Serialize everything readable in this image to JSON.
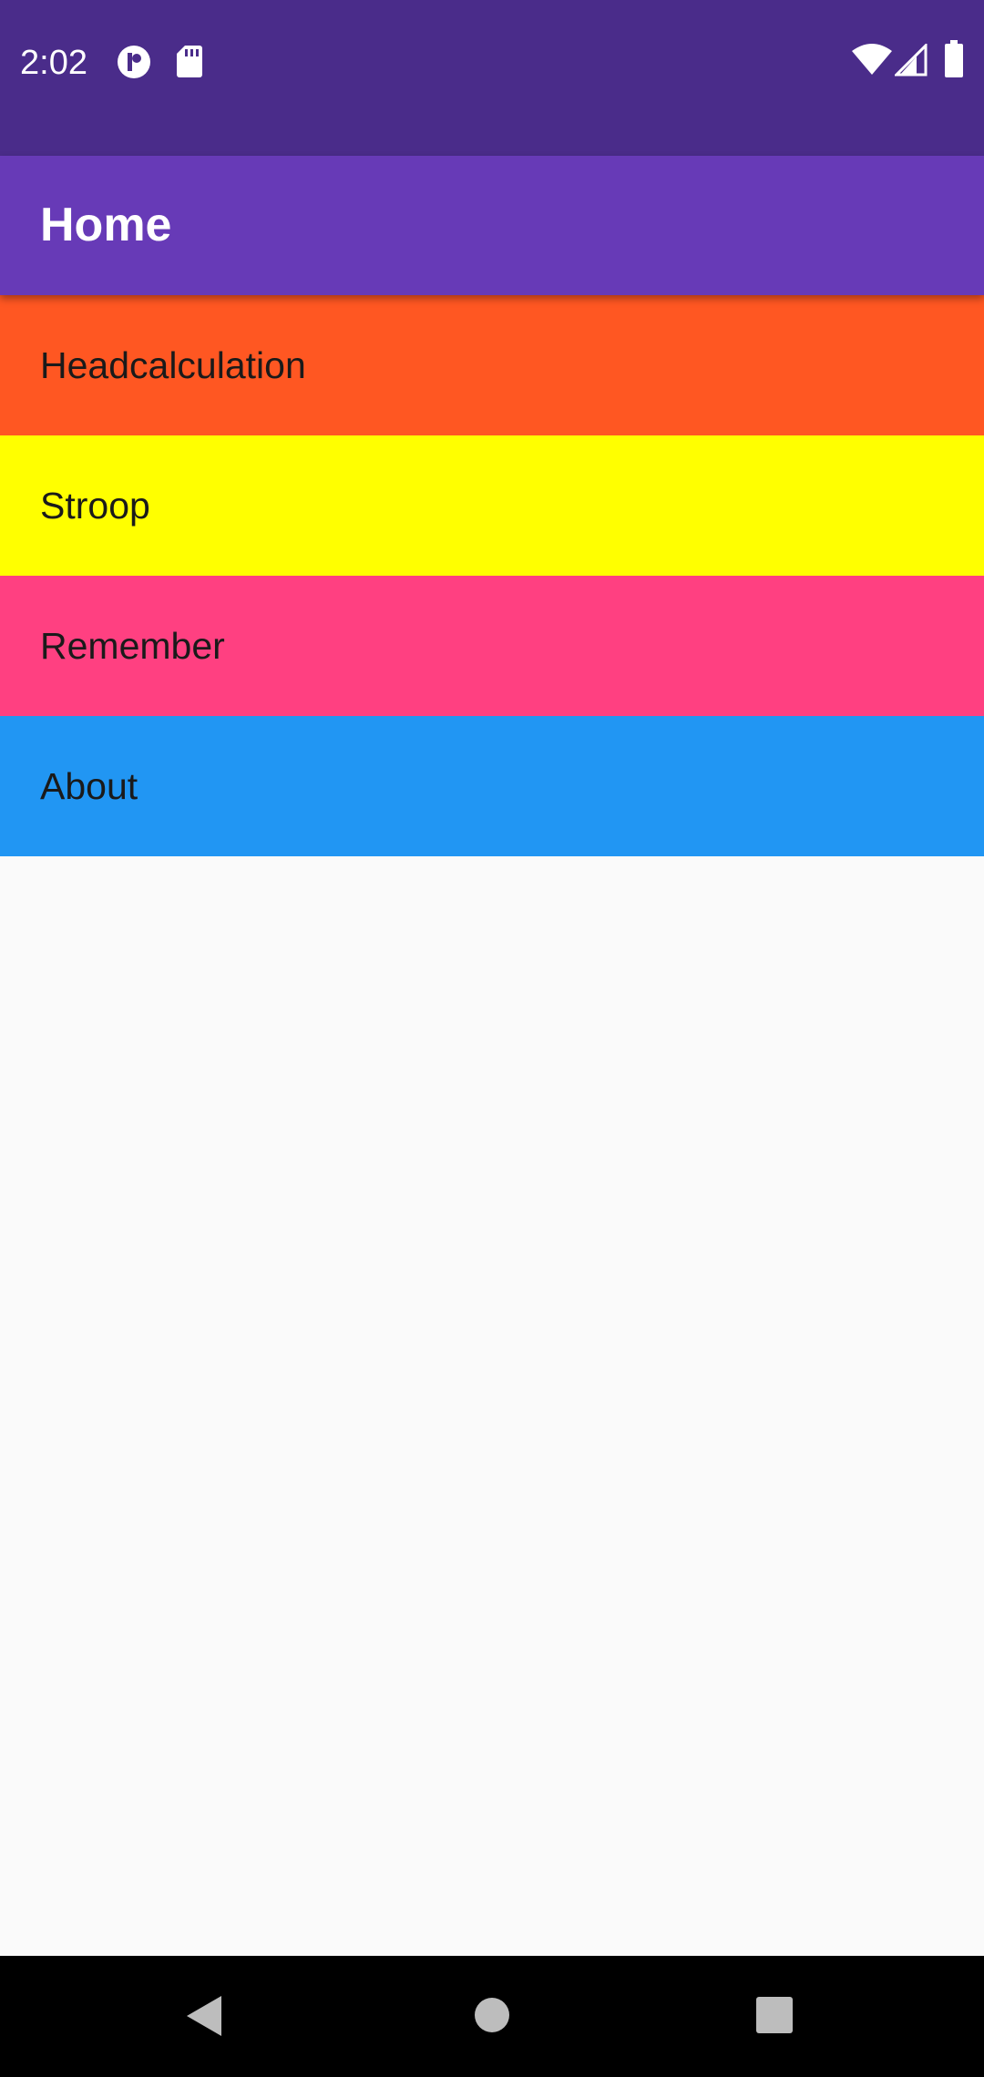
{
  "status_bar": {
    "time": "2:02",
    "background": "#4A2C8A",
    "icons": [
      "app-notification-icon",
      "sd-card-icon",
      "wifi-icon",
      "cell-signal-icon",
      "battery-icon"
    ]
  },
  "app_bar": {
    "title": "Home",
    "background": "#673AB7"
  },
  "menu": {
    "items": [
      {
        "label": "Headcalculation",
        "color": "#FF5722"
      },
      {
        "label": "Stroop",
        "color": "#FFFF00"
      },
      {
        "label": "Remember",
        "color": "#FF4081"
      },
      {
        "label": "About",
        "color": "#2196F3"
      }
    ]
  },
  "nav_bar": {
    "buttons": [
      "back-icon",
      "home-icon",
      "recents-icon"
    ]
  }
}
